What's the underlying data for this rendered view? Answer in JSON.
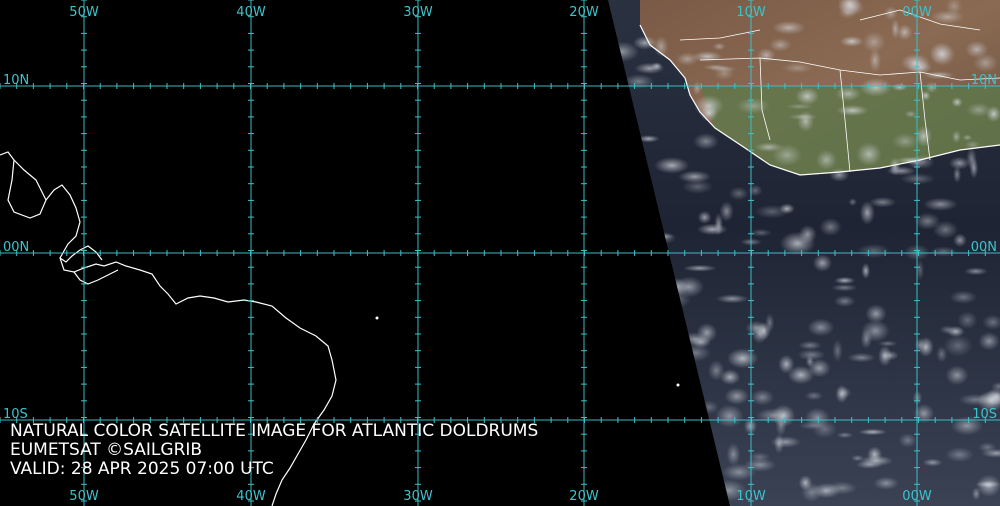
{
  "map": {
    "longitude_labels": [
      "50W",
      "40W",
      "30W",
      "20W",
      "10W",
      "00W"
    ],
    "latitude_labels": [
      "10N",
      "00N",
      "10S"
    ],
    "grid_color": "#3cc4cc",
    "coastline_color": "#ffffff",
    "ocean_color": "#000000"
  },
  "caption": {
    "line1": "NATURAL COLOR SATELLITE IMAGE FOR ATLANTIC DOLDRUMS",
    "line2": "EUMETSAT ©SAILGRIB",
    "line3": "VALID:  28 APR 2025 07:00 UTC"
  }
}
